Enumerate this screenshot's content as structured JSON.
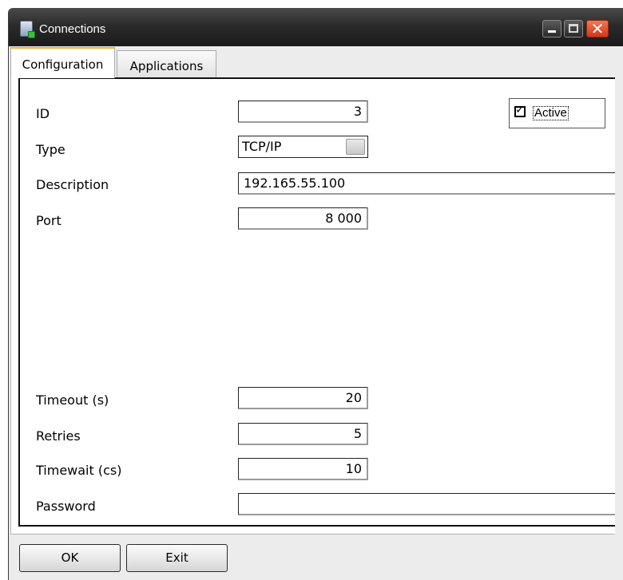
{
  "window": {
    "title": "Connections",
    "controls": [
      "minimize",
      "maximize",
      "close"
    ],
    "close_glyph": "✕"
  },
  "tabs": [
    {
      "label": "Configuration",
      "active": true
    },
    {
      "label": "Applications",
      "active": false
    }
  ],
  "form": {
    "id": {
      "label": "ID",
      "value": "3"
    },
    "type": {
      "label": "Type",
      "value": "TCP/IP"
    },
    "description": {
      "label": "Description",
      "value": "192.165.55.100"
    },
    "port": {
      "label": "Port",
      "value": "8 000"
    },
    "timeout": {
      "label": "Timeout (s)",
      "value": "20"
    },
    "retries": {
      "label": "Retries",
      "value": "5"
    },
    "timewait": {
      "label": "Timewait (cs)",
      "value": "10"
    },
    "password": {
      "label": "Password",
      "value": ""
    },
    "active": {
      "label": "Active",
      "checked": true,
      "mark": "✓"
    }
  },
  "buttons": {
    "ok": "OK",
    "exit": "Exit"
  },
  "colors": {
    "titlebar": "#2b2b2b",
    "close_button": "#d3361a",
    "active_tab_accent": "#f3b23b"
  }
}
